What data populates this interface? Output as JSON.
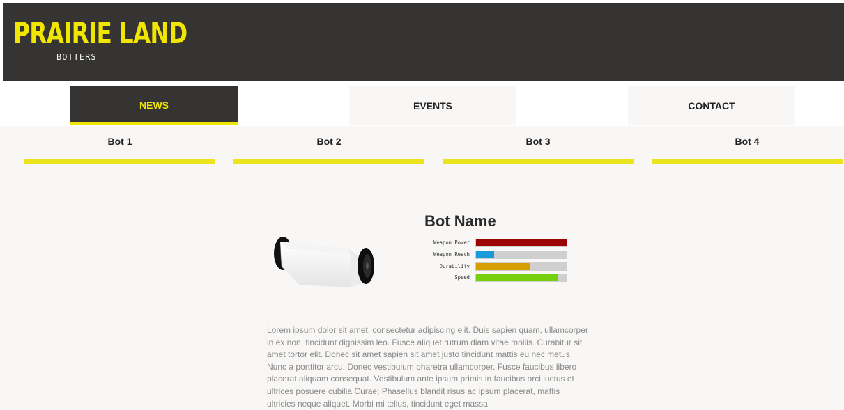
{
  "header": {
    "logo_title": "PRAIRIE LAND",
    "logo_subtitle": "BOTTERS"
  },
  "nav": {
    "tabs": [
      {
        "label": "NEWS",
        "active": true
      },
      {
        "label": "EVENTS",
        "active": false
      },
      {
        "label": "CONTACT",
        "active": false
      }
    ]
  },
  "bot_tabs": [
    {
      "label": "Bot 1"
    },
    {
      "label": "Bot 2"
    },
    {
      "label": "Bot 3"
    },
    {
      "label": "Bot 4"
    }
  ],
  "bot": {
    "name": "Bot Name",
    "image_icon": "robot-image",
    "stats": [
      {
        "label": "Weapon Power",
        "value": 1.0,
        "color": "#9b0505"
      },
      {
        "label": "Weapon Reach",
        "value": 0.2,
        "color": "#1a9ad8"
      },
      {
        "label": "Durability",
        "value": 0.6,
        "color": "#d89e00"
      },
      {
        "label": "Speed",
        "value": 0.9,
        "color": "#76cf0c"
      }
    ],
    "description": "Lorem ipsum dolor sit amet, consectetur adipiscing elit. Duis sapien quam, ullamcorper in ex non, tincidunt dignissim leo. Fusce aliquet rutrum diam vitae mollis. Curabitur sit amet tortor elit. Donec sit amet sapien sit amet justo tincidunt mattis eu nec metus. Nunc a porttitor arcu. Donec vestibulum pharetra ullamcorper. Fusce faucibus libero placerat aliquam consequat. Vestibulum ante ipsum primis in faucibus orci luctus et ultrices posuere cubilia Curae; Phasellus blandit risus ac ipsum placerat, mattis ultricies neque aliquet. Morbi mi tellus, tincidunt eget massa"
  },
  "colors": {
    "header_bg": "#353432",
    "accent_yellow": "#f0e600",
    "content_bg": "#f8f7f6"
  }
}
